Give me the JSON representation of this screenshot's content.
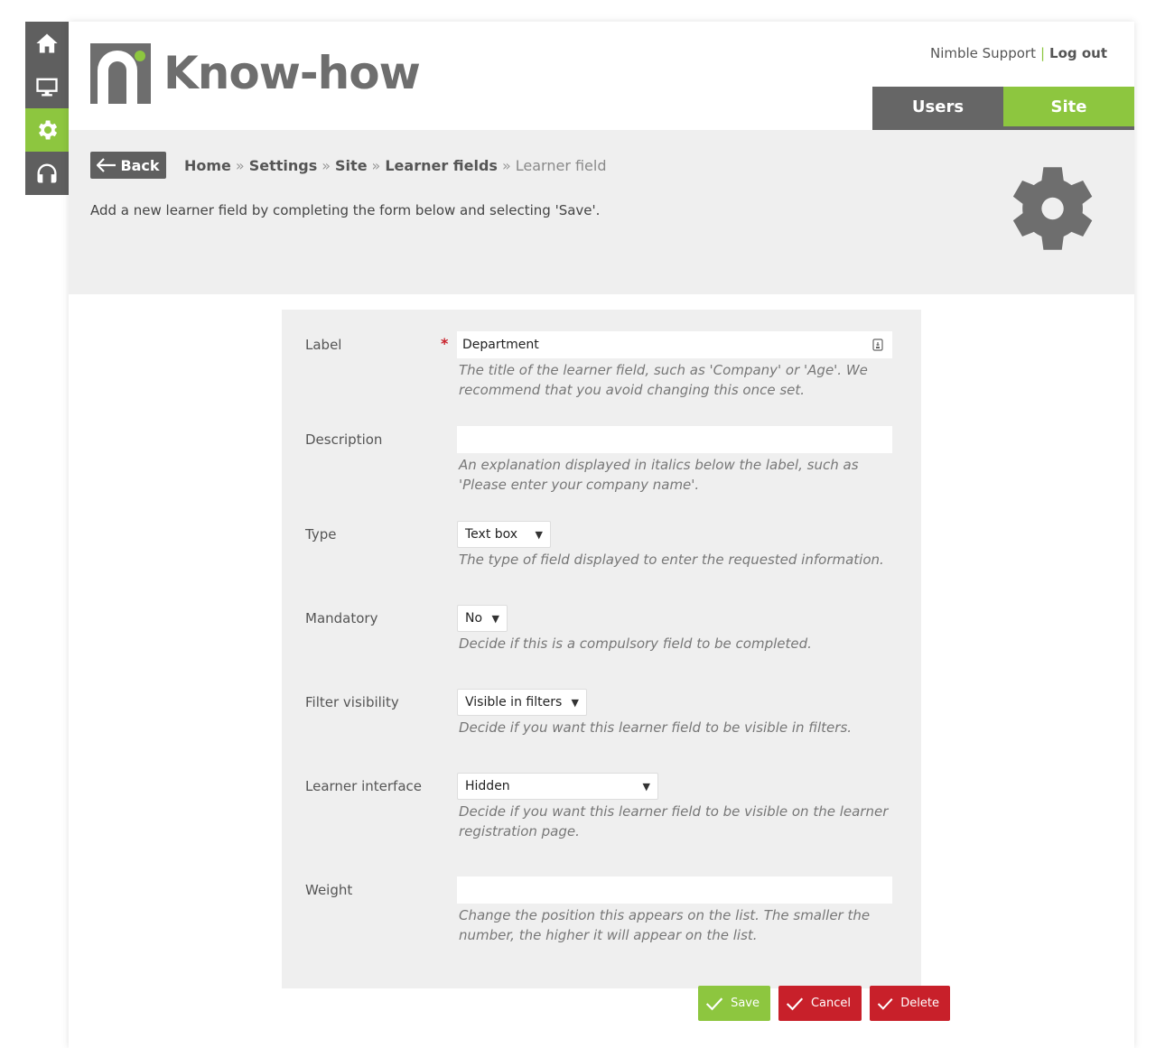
{
  "header": {
    "brand": "Know-how",
    "user_name": "Nimble Support",
    "logout_label": "Log out",
    "separator": "|"
  },
  "tabs": [
    {
      "label": "Users",
      "active": false
    },
    {
      "label": "Site",
      "active": true
    }
  ],
  "side_nav": {
    "items": [
      {
        "icon": "home-icon",
        "active": false
      },
      {
        "icon": "monitor-icon",
        "active": false
      },
      {
        "icon": "gear-icon",
        "active": true
      },
      {
        "icon": "headphones-icon",
        "active": false
      }
    ]
  },
  "banner": {
    "back_label": "Back",
    "breadcrumb": [
      "Home",
      "Settings",
      "Site",
      "Learner fields"
    ],
    "breadcrumb_current": "Learner field",
    "breadcrumb_sep": "»",
    "intro": "Add a new learner field by completing the form below and selecting 'Save'."
  },
  "form": {
    "label": {
      "label": "Label",
      "required_mark": "*",
      "value": "Department",
      "help": "The title of the learner field, such as 'Company' or 'Age'. We recommend that you avoid changing this once set."
    },
    "description": {
      "label": "Description",
      "value": "",
      "help": "An explanation displayed in italics below the label, such as 'Please enter your company name'."
    },
    "type": {
      "label": "Type",
      "selected": "Text box",
      "help": "The type of field displayed to enter the requested information."
    },
    "mandatory": {
      "label": "Mandatory",
      "selected": "No",
      "help": "Decide if this is a compulsory field to be completed."
    },
    "filter_visibility": {
      "label": "Filter visibility",
      "selected": "Visible in filters",
      "help": "Decide if you want this learner field to be visible in filters."
    },
    "learner_interface": {
      "label": "Learner interface",
      "selected": "Hidden",
      "help": "Decide if you want this learner field to be visible on the learner registration page."
    },
    "weight": {
      "label": "Weight",
      "value": "",
      "help": "Change the position this appears on the list. The smaller the number, the higher it will appear on the list."
    }
  },
  "actions": {
    "save_label": "Save",
    "cancel_label": "Cancel",
    "delete_label": "Delete"
  },
  "colors": {
    "accent_green": "#8dc63f",
    "dark_gray": "#5f5f5f",
    "danger_red": "#c8202a",
    "panel_gray": "#efefef"
  }
}
